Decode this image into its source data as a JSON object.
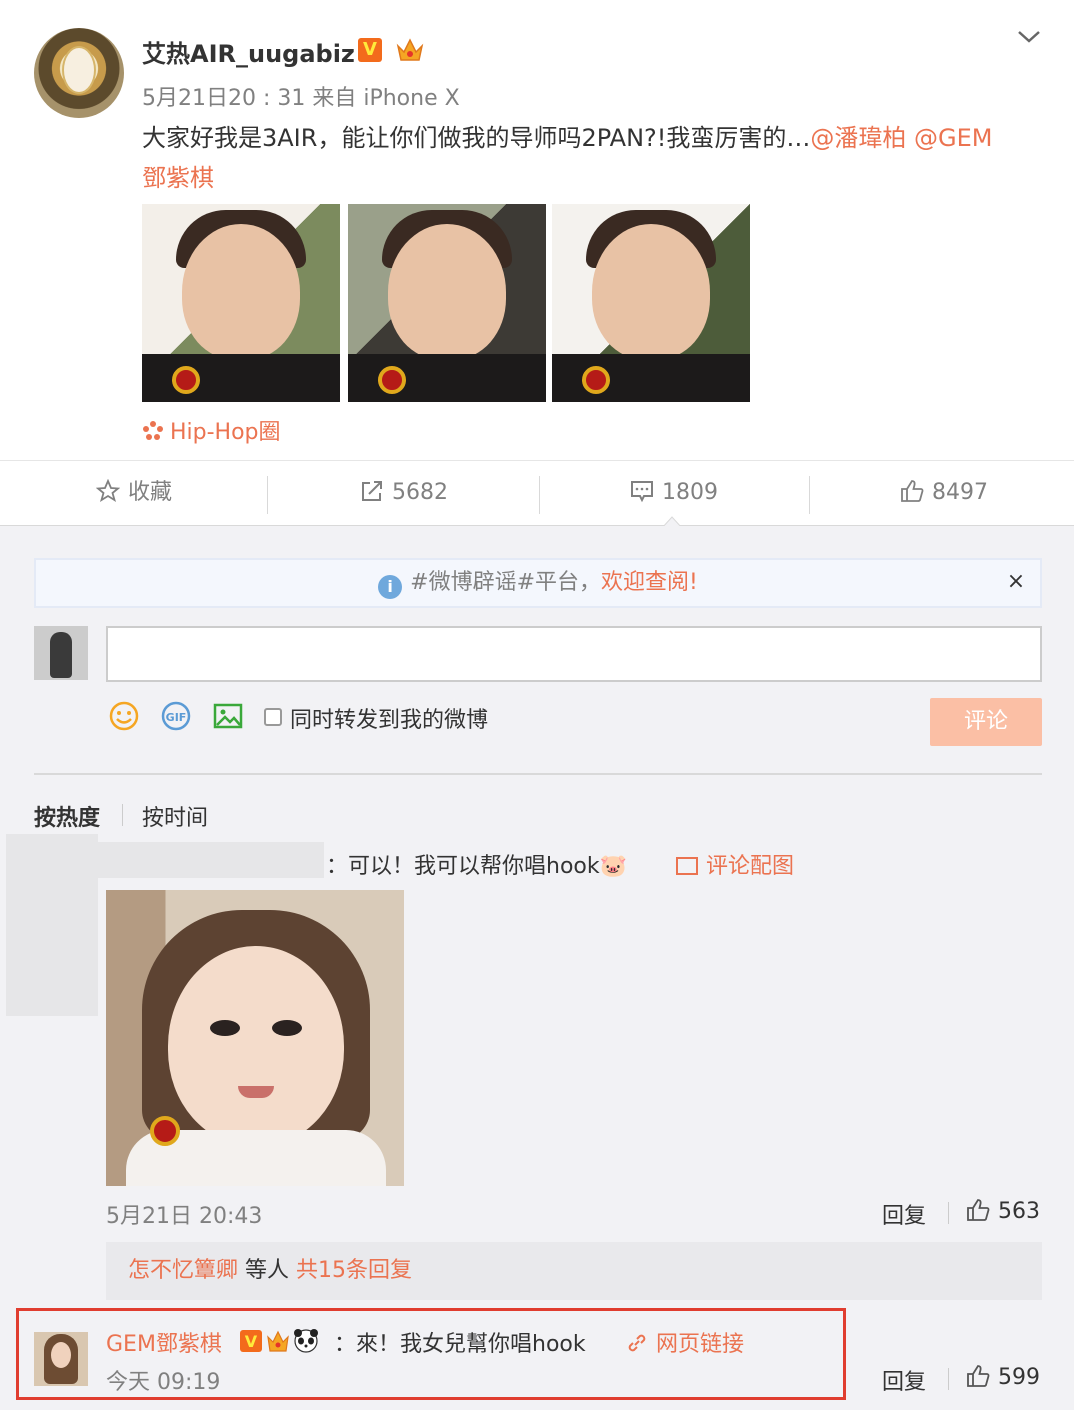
{
  "post": {
    "username": "艾热AIR_uugabiz",
    "verified_badge": "V",
    "meta": "5月21日20 : 31 来自 iPhone X",
    "text_main": "大家好我是3AIR，能让你们做我的导师吗2PAN?!我蛮厉害的…",
    "mention1": "@潘瑋柏",
    "mention2": "@GEM",
    "mention2_cont": "鄧紫棋",
    "topic": "Hip-Hop圈",
    "icons": [
      "chevron-down-icon",
      "crown-badge-icon",
      "topic-flower-icon"
    ]
  },
  "actions": {
    "favorite": "收藏",
    "repost_count": "5682",
    "comment_count": "1809",
    "like_count": "8497"
  },
  "comment_box": {
    "notice_prefix": "#微博辟谣#平台，",
    "notice_link": "欢迎查阅!",
    "notice_close": "×",
    "input_value": "",
    "forward_label": "同时转发到我的微博",
    "submit_label": "评论"
  },
  "sort": {
    "hot": "按热度",
    "time": "按时间"
  },
  "comments": [
    {
      "text": "：可以！我可以帮你唱hook🐷",
      "pic_link": "评论配图",
      "time": "5月21日 20:43",
      "reply_label": "回复",
      "likes": "563",
      "replies_user": "怎不忆簟卿",
      "replies_mid": " 等人 ",
      "replies_more": "共15条回复"
    },
    {
      "name": "GEM鄧紫棋",
      "text": "：來！我女兒幫你唱hook",
      "link": "网页链接",
      "time": "今天 09:19",
      "reply_label": "回复",
      "likes": "599"
    }
  ],
  "colors": {
    "accent": "#eb7350",
    "highlight_border": "#e03d2f",
    "submit_disabled": "#fbbfa5"
  }
}
